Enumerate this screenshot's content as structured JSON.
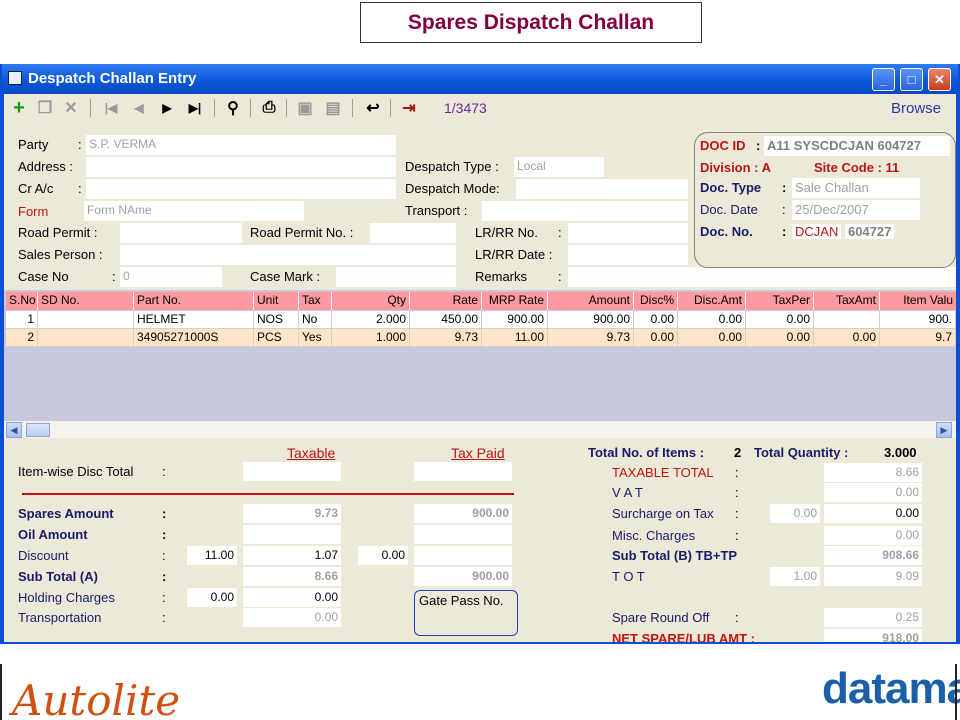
{
  "slide_title": "Spares Dispatch Challan",
  "window": {
    "title": "Despatch Challan Entry",
    "controls": [
      "minimize-icon",
      "maximize-icon",
      "close-icon"
    ]
  },
  "toolbar": {
    "icons": [
      "add-icon",
      "copy-icon",
      "delete-icon",
      "first-record-icon",
      "previous-record-icon",
      "next-record-icon",
      "last-record-icon",
      "find-icon",
      "print-icon",
      "save-icon",
      "cancel-icon",
      "undo-icon",
      "exit-icon"
    ],
    "record_counter": "1/3473",
    "browse_label": "Browse"
  },
  "header": {
    "party_label": "Party",
    "party_value": "S.P. VERMA",
    "address_label": "Address :",
    "cr_ac_label": "Cr A/c",
    "form_label": "Form",
    "form_placeholder": "Form NAme",
    "road_permit_label": "Road Permit :",
    "road_permit_no_label": "Road Permit No. :",
    "sales_person_label": "Sales Person :",
    "case_no_label": "Case No",
    "case_no_value": "0",
    "case_mark_label": "Case Mark :",
    "despatch_type_label": "Despatch Type :",
    "despatch_type_value": "Local",
    "despatch_mode_label": "Despatch Mode:",
    "transport_label": "Transport :",
    "lr_no_label": "LR/RR No.",
    "lr_date_label": "LR/RR Date :",
    "remarks_label": "Remarks",
    "colon": ":"
  },
  "doc": {
    "doc_id_label": "DOC ID",
    "doc_id_value": "A11 SYSCDCJAN  604727",
    "division_label": "Division : A",
    "site_code_label": "Site Code : 11",
    "doc_type_label": "Doc. Type",
    "doc_type_value": "Sale Challan",
    "doc_date_label": "Doc. Date",
    "doc_date_value": "25/Dec/2007",
    "doc_no_label": "Doc. No.",
    "doc_no_prefix": "DCJAN",
    "doc_no_value": "604727"
  },
  "grid": {
    "columns": [
      "S.No",
      "SD No.",
      "Part No.",
      "Unit",
      "Tax",
      "Qty",
      "Rate",
      "MRP Rate",
      "Amount",
      "Disc%",
      "Disc.Amt",
      "TaxPer",
      "TaxAmt",
      "Item Valu"
    ],
    "rows": [
      [
        "1",
        "",
        "HELMET",
        "NOS",
        "No",
        "2.000",
        "450.00",
        "900.00",
        "900.00",
        "0.00",
        "0.00",
        "0.00",
        "",
        "900."
      ],
      [
        "2",
        "",
        "34905271000S",
        "PCS",
        "Yes",
        "1.000",
        "9.73",
        "11.00",
        "9.73",
        "0.00",
        "0.00",
        "0.00",
        "0.00",
        "9.7"
      ]
    ]
  },
  "summary_left": {
    "taxable_header": "Taxable",
    "tax_paid_header": "Tax Paid",
    "item_disc_label": "Item-wise Disc Total",
    "spares_amount_label": "Spares Amount",
    "spares_taxable": "9.73",
    "spares_taxpaid": "900.00",
    "oil_amount_label": "Oil Amount",
    "discount_label": "Discount",
    "discount_pct": "11.00",
    "discount_taxable": "1.07",
    "discount_taxpaid": "0.00",
    "subtotal_a_label": "Sub Total (A)",
    "subtotal_a_taxable": "8.66",
    "subtotal_a_taxpaid": "900.00",
    "holding_label": "Holding Charges",
    "holding_pct": "0.00",
    "holding_taxable": "0.00",
    "transport_label": "Transportation",
    "transport_taxable": "0.00",
    "gate_pass_label": "Gate Pass No.",
    "colon": ":"
  },
  "summary_right": {
    "total_items_label": "Total No. of Items :",
    "total_items_value": "2",
    "total_qty_label": "Total Quantity :",
    "total_qty_value": "3.000",
    "taxable_total_label": "TAXABLE TOTAL",
    "taxable_total_value": "8.66",
    "vat_label": "V A T",
    "vat_value": "0.00",
    "surcharge_label": "Surcharge on Tax",
    "surcharge_pct": "0.00",
    "surcharge_value": "0.00",
    "misc_label": "Misc. Charges",
    "misc_value": "0.00",
    "subtotal_b_label": "Sub Total (B) TB+TP",
    "subtotal_b_value": "908.66",
    "tot_label": "T O T",
    "tot_pct": "1.00",
    "tot_value": "9.09",
    "round_off_label": "Spare Round Off",
    "round_off_value": "0.25",
    "net_label": "NET SPARE/LUB AMT :",
    "net_value": "918.00",
    "colon": ":"
  },
  "logos": {
    "left": "Autolite",
    "right": "dataman"
  }
}
